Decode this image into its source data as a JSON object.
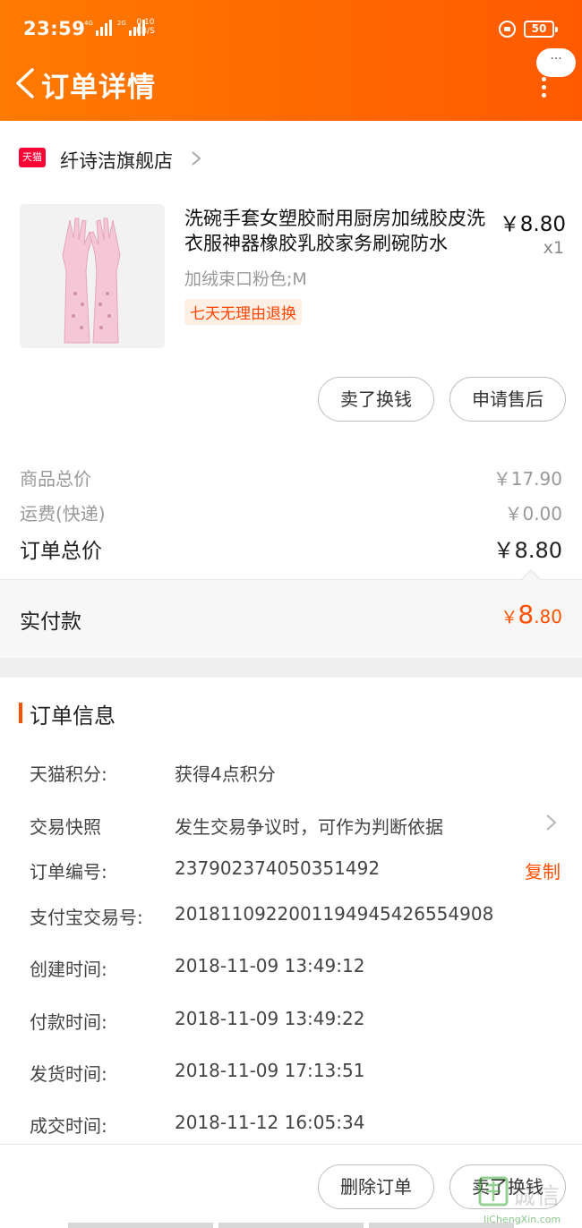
{
  "status_bar": {
    "time": "23:59",
    "network1": "4G",
    "network2": "2G",
    "netspeed_value": "0.10",
    "netspeed_unit": "KB/S",
    "battery": "50"
  },
  "header": {
    "title": "订单详情",
    "more_label": "···"
  },
  "store": {
    "badge": "天猫",
    "name": "纤诗洁旗舰店"
  },
  "product": {
    "title": "洗碗手套女塑胶耐用厨房加绒胶皮洗衣服神器橡胶乳胶家务刷碗防水",
    "price": "￥8.80",
    "quantity": "x1",
    "sku": "加绒束口粉色;M",
    "tag": "七天无理由退换"
  },
  "actions": {
    "sell_label": "卖了换钱",
    "after_sale_label": "申请售后"
  },
  "summary": {
    "goods_label": "商品总价",
    "goods_value": "￥17.90",
    "shipping_label": "运费(快递)",
    "shipping_value": "￥0.00",
    "total_label": "订单总价",
    "total_value": "￥8.80",
    "paid_label": "实付款",
    "paid_currency": "￥",
    "paid_int": "8",
    "paid_dec": ".80"
  },
  "order_info": {
    "title": "订单信息",
    "rows": [
      {
        "label": "天猫积分:",
        "value": "获得4点积分"
      },
      {
        "label": "交易快照",
        "value": "发生交易争议时，可作为判断依据"
      },
      {
        "label": "订单编号:",
        "value": "237902374050351492"
      },
      {
        "label": "支付宝交易号:",
        "value": "2018110922001194945426554908"
      },
      {
        "label": "创建时间:",
        "value": "2018-11-09 13:49:12"
      },
      {
        "label": "付款时间:",
        "value": "2018-11-09 13:49:22"
      },
      {
        "label": "发货时间:",
        "value": "2018-11-09 17:13:51"
      },
      {
        "label": "成交时间:",
        "value": "2018-11-12 16:05:34"
      }
    ],
    "copy_label": "复制"
  },
  "bottom": {
    "delete_label": "删除订单",
    "sell_label": "卖了换钱"
  },
  "watermark": {
    "text": "诚信",
    "sub": "JiChengXin.com"
  },
  "colors": {
    "accent": "#ff5000",
    "header_start": "#ff7a00",
    "tmall_red": "#ff0036"
  }
}
